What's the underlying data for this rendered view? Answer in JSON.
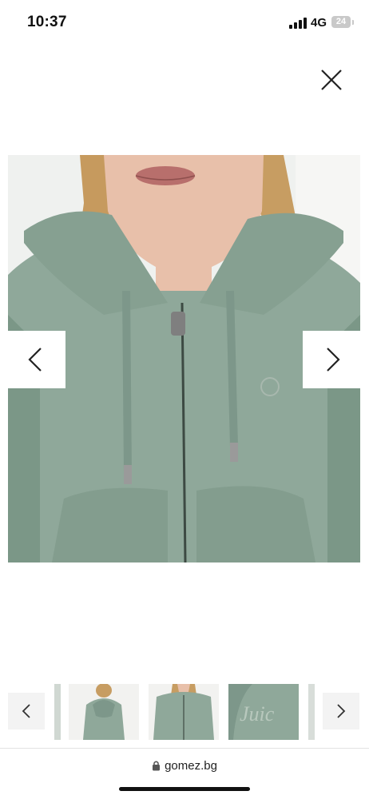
{
  "status": {
    "time": "10:37",
    "network": "4G",
    "battery": "24"
  },
  "icons": {
    "close": "close-icon",
    "prev": "chevron-left-icon",
    "next": "chevron-right-icon",
    "lock": "lock-icon",
    "signal": "signal-icon"
  },
  "gallery": {
    "main_image": "sage green velour zip hoodie front view",
    "thumbnails": [
      "back view",
      "front view",
      "back logo close-up"
    ],
    "thumbnail_logo_text": "Juic"
  },
  "browser": {
    "url": "gomez.bg"
  },
  "colors": {
    "hoodie": "#8fa89a",
    "hoodie_dark": "#7a9586",
    "hair": "#c9a066",
    "skin": "#e9c3ad"
  }
}
